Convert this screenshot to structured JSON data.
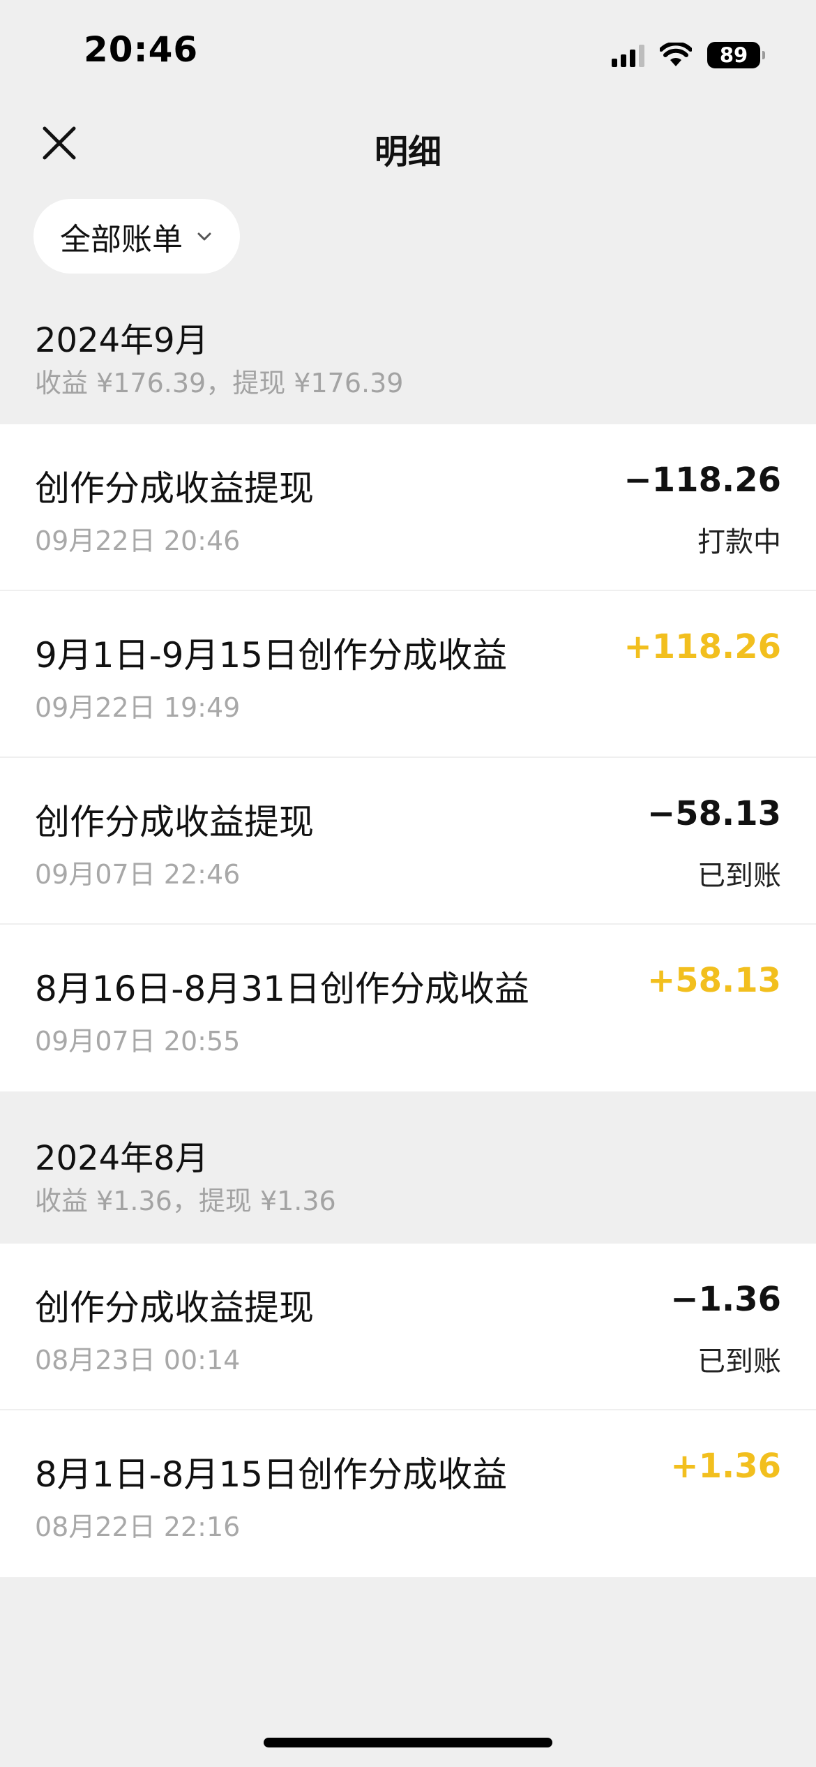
{
  "status_bar": {
    "time": "20:46",
    "battery": "89"
  },
  "nav": {
    "title": "明细",
    "close_icon": "close-icon"
  },
  "filter": {
    "label": "全部账单",
    "icon": "chevron-down-icon"
  },
  "colors": {
    "positive": "#f2bf1e",
    "negative": "#111111",
    "muted": "#a8a8a8",
    "background": "#efefef"
  },
  "sections": [
    {
      "month": "2024年9月",
      "summary": "收益 ¥176.39，提现 ¥176.39",
      "items": [
        {
          "title": "创作分成收益提现",
          "date": "09月22日 20:46",
          "amount": "−118.26",
          "status": "打款中"
        },
        {
          "title": "9月1日-9月15日创作分成收益",
          "date": "09月22日 19:49",
          "amount": "+118.26",
          "status": ""
        },
        {
          "title": "创作分成收益提现",
          "date": "09月07日 22:46",
          "amount": "−58.13",
          "status": "已到账"
        },
        {
          "title": "8月16日-8月31日创作分成收益",
          "date": "09月07日 20:55",
          "amount": "+58.13",
          "status": ""
        }
      ]
    },
    {
      "month": "2024年8月",
      "summary": "收益 ¥1.36，提现 ¥1.36",
      "items": [
        {
          "title": "创作分成收益提现",
          "date": "08月23日 00:14",
          "amount": "−1.36",
          "status": "已到账"
        },
        {
          "title": "8月1日-8月15日创作分成收益",
          "date": "08月22日 22:16",
          "amount": "+1.36",
          "status": ""
        }
      ]
    }
  ]
}
